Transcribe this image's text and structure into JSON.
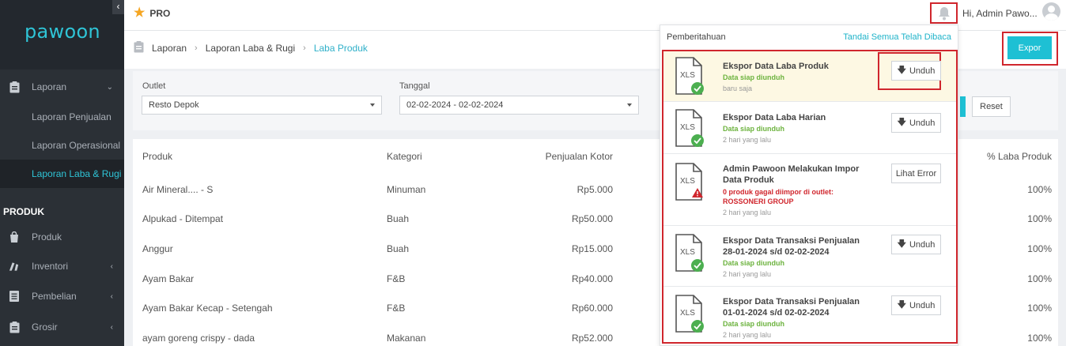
{
  "app": {
    "logo": "pawoon",
    "plan": "PRO",
    "greeting": "Hi, Admin Pawo..."
  },
  "sidebar": {
    "section_heading": "PRODUK",
    "items": [
      {
        "label": "Laporan",
        "icon": "clipboard-icon"
      },
      {
        "label": "Produk",
        "icon": "bag-icon"
      },
      {
        "label": "Inventori",
        "icon": "boxes-icon"
      },
      {
        "label": "Pembelian",
        "icon": "receipt-icon"
      },
      {
        "label": "Grosir",
        "icon": "clipboard-icon"
      }
    ],
    "subitems": [
      "Laporan Penjualan",
      "Laporan Operasional",
      "Laporan Laba & Rugi"
    ]
  },
  "breadcrumb": [
    "Laporan",
    "Laporan Laba & Rugi",
    "Laba Produk"
  ],
  "toolbar": {
    "export_label": "Expor",
    "reset_label": "Reset"
  },
  "filters": {
    "outlet_label": "Outlet",
    "outlet_value": "Resto Depok",
    "date_label": "Tanggal",
    "date_value": "02-02-2024 - 02-02-2024"
  },
  "table": {
    "headers": [
      "Produk",
      "Kategori",
      "Penjualan Kotor",
      "% Laba Produk"
    ],
    "rows": [
      {
        "produk": "Air Mineral.... - S",
        "kategori": "Minuman",
        "penjualan": "Rp5.000",
        "laba": "100%"
      },
      {
        "produk": "Alpukad - Ditempat",
        "kategori": "Buah",
        "penjualan": "Rp50.000",
        "laba": "100%"
      },
      {
        "produk": "Anggur",
        "kategori": "Buah",
        "penjualan": "Rp15.000",
        "laba": "100%"
      },
      {
        "produk": "Ayam Bakar",
        "kategori": "F&B",
        "penjualan": "Rp40.000",
        "laba": "100%"
      },
      {
        "produk": "Ayam Bakar Kecap - Setengah",
        "kategori": "F&B",
        "penjualan": "Rp60.000",
        "laba": "100%"
      },
      {
        "produk": "ayam goreng crispy - dada",
        "kategori": "Makanan",
        "penjualan": "Rp52.000",
        "laba": "100%"
      }
    ]
  },
  "notifications": {
    "title": "Pemberitahuan",
    "mark_all": "Tandai Semua Telah Dibaca",
    "file_badge": "XLS",
    "items": [
      {
        "title": "Ekspor Data Laba Produk",
        "status": "Data siap diunduh",
        "time": "baru saja",
        "button": "Unduh",
        "state": "success"
      },
      {
        "title": "Ekspor Data Laba Harian",
        "status": "Data siap diunduh",
        "time": "2 hari yang lalu",
        "button": "Unduh",
        "state": "success"
      },
      {
        "title": "Admin Pawoon Melakukan Impor Data Produk",
        "status": "0 produk gagal diimpor di outlet: ROSSONERI GROUP",
        "time": "2 hari yang lalu",
        "button": "Lihat Error",
        "state": "error"
      },
      {
        "title": "Ekspor Data Transaksi Penjualan 28-01-2024 s/d 02-02-2024",
        "status": "Data siap diunduh",
        "time": "2 hari yang lalu",
        "button": "Unduh",
        "state": "success"
      },
      {
        "title": "Ekspor Data Transaksi Penjualan 01-01-2024 s/d 02-02-2024",
        "status": "Data siap diunduh",
        "time": "2 hari yang lalu",
        "button": "Unduh",
        "state": "success"
      }
    ]
  },
  "colors": {
    "accent": "#1ec0d4",
    "sidebar": "#2b3036",
    "success": "#4caf50",
    "error": "#d0262d",
    "highlight": "#fdf8e3"
  }
}
